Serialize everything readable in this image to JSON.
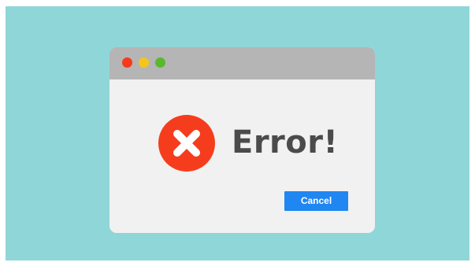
{
  "dialog": {
    "message": "Error!",
    "cancel_label": "Cancel",
    "icon": "error-x-circle-icon"
  },
  "titlebar": {
    "controls": [
      "close",
      "minimize",
      "maximize"
    ]
  },
  "colors": {
    "background": "#8fd6d9",
    "window": "#f1f1f1",
    "titlebar": "#b5b5b5",
    "close_dot": "#f53a1e",
    "minimize_dot": "#f5c51b",
    "maximize_dot": "#5ab82f",
    "error_icon": "#f53d1e",
    "message_text": "#4b4b4b",
    "cancel_button": "#1f86f2"
  }
}
